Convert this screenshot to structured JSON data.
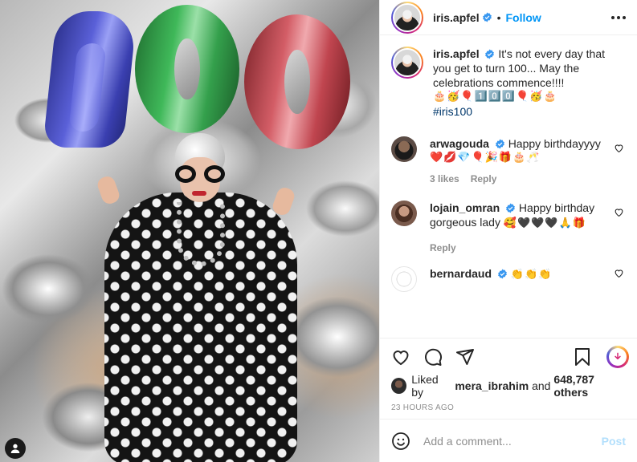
{
  "post": {
    "username": "iris.apfel",
    "separator": "•",
    "follow_label": "Follow",
    "caption_text": "It's not every day that you get to turn 100... May the celebrations commence!!!!",
    "caption_emojis": "🎂🥳🎈1️⃣0️⃣0️⃣🎈🥳🎂",
    "caption_hashtag": "#iris100"
  },
  "comments": [
    {
      "username": "arwagouda",
      "text": "Happy birthdayyyy",
      "emojis": "❤️💋💎🎈🎉🎁🎂🥂",
      "likes": "3 likes",
      "reply_label": "Reply"
    },
    {
      "username": "lojain_omran",
      "text": "Happy birthday gorgeous lady",
      "emojis": "🥰🖤🖤🖤🙏🎁",
      "reply_label": "Reply"
    },
    {
      "username": "bernardaud",
      "text": "",
      "emojis": "👏👏👏"
    }
  ],
  "likes_line": {
    "prefix": "Liked by",
    "user": "mera_ibrahim",
    "middle": "and",
    "others": "648,787 others"
  },
  "timestamp": "23 HOURS AGO",
  "add_comment": {
    "placeholder": "Add a comment...",
    "post_label": "Post"
  },
  "colors": {
    "link_blue": "#0095f6",
    "post_disabled": "#b2dffc",
    "verified": "#3897f0"
  },
  "icons": [
    "heart-icon",
    "comment-icon",
    "share-icon",
    "bookmark-icon",
    "emoji-icon",
    "more-icon",
    "verified-icon",
    "user-tag-icon"
  ]
}
